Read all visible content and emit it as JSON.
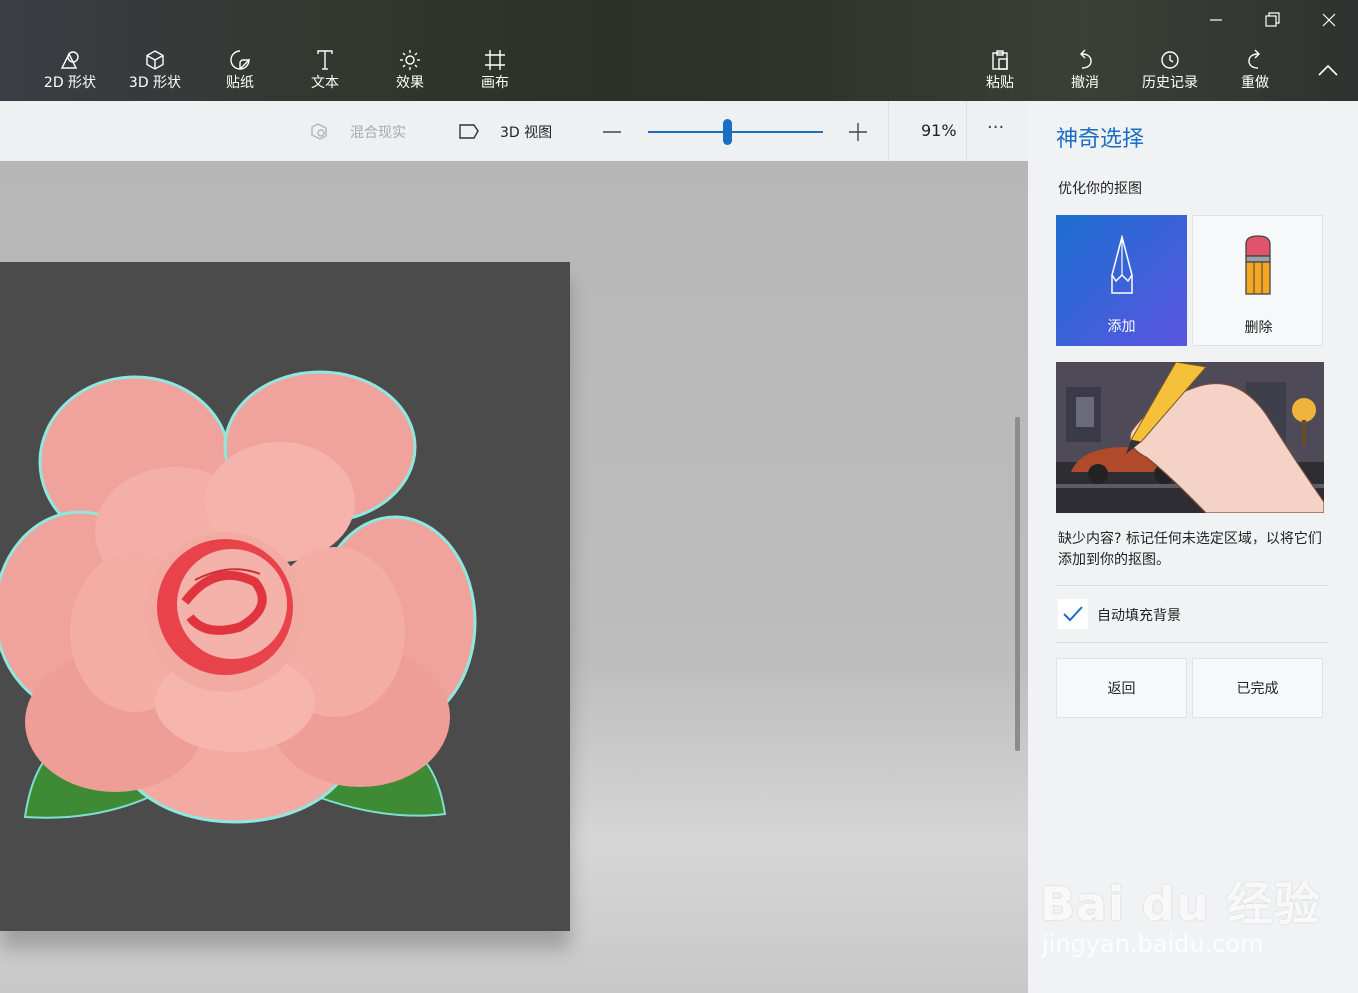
{
  "toolbar": {
    "tools": [
      {
        "label": "2D 形状",
        "icon": "2d-shapes-icon"
      },
      {
        "label": "3D 形状",
        "icon": "3d-shapes-icon"
      },
      {
        "label": "贴纸",
        "icon": "stickers-icon"
      },
      {
        "label": "文本",
        "icon": "text-icon"
      },
      {
        "label": "效果",
        "icon": "effects-icon"
      },
      {
        "label": "画布",
        "icon": "canvas-icon"
      }
    ],
    "actions": [
      {
        "label": "粘贴",
        "icon": "paste-icon"
      },
      {
        "label": "撤消",
        "icon": "undo-icon"
      },
      {
        "label": "历史记录",
        "icon": "history-icon"
      },
      {
        "label": "重做",
        "icon": "redo-icon"
      }
    ]
  },
  "viewbar": {
    "mixed_reality": "混合现实",
    "view_3d": "3D 视图",
    "zoom": "91%",
    "zoom_fraction": 0.45,
    "more": "···"
  },
  "panel": {
    "title": "神奇选择",
    "subtitle": "优化你的抠图",
    "add_label": "添加",
    "remove_label": "删除",
    "description": "缺少内容? 标记任何未选定区域，以将它们添加到你的抠图。",
    "autofill_label": "自动填充背景",
    "autofill_checked": true,
    "back_label": "返回",
    "done_label": "已完成"
  },
  "watermark": {
    "brand": "Bai du 经验",
    "url": "jingyan.baidu.com"
  },
  "colors": {
    "accent": "#1a6fc4",
    "add_tile_from": "#1b6fd0",
    "add_tile_to": "#5b55e0",
    "arrow": "#e53935"
  }
}
